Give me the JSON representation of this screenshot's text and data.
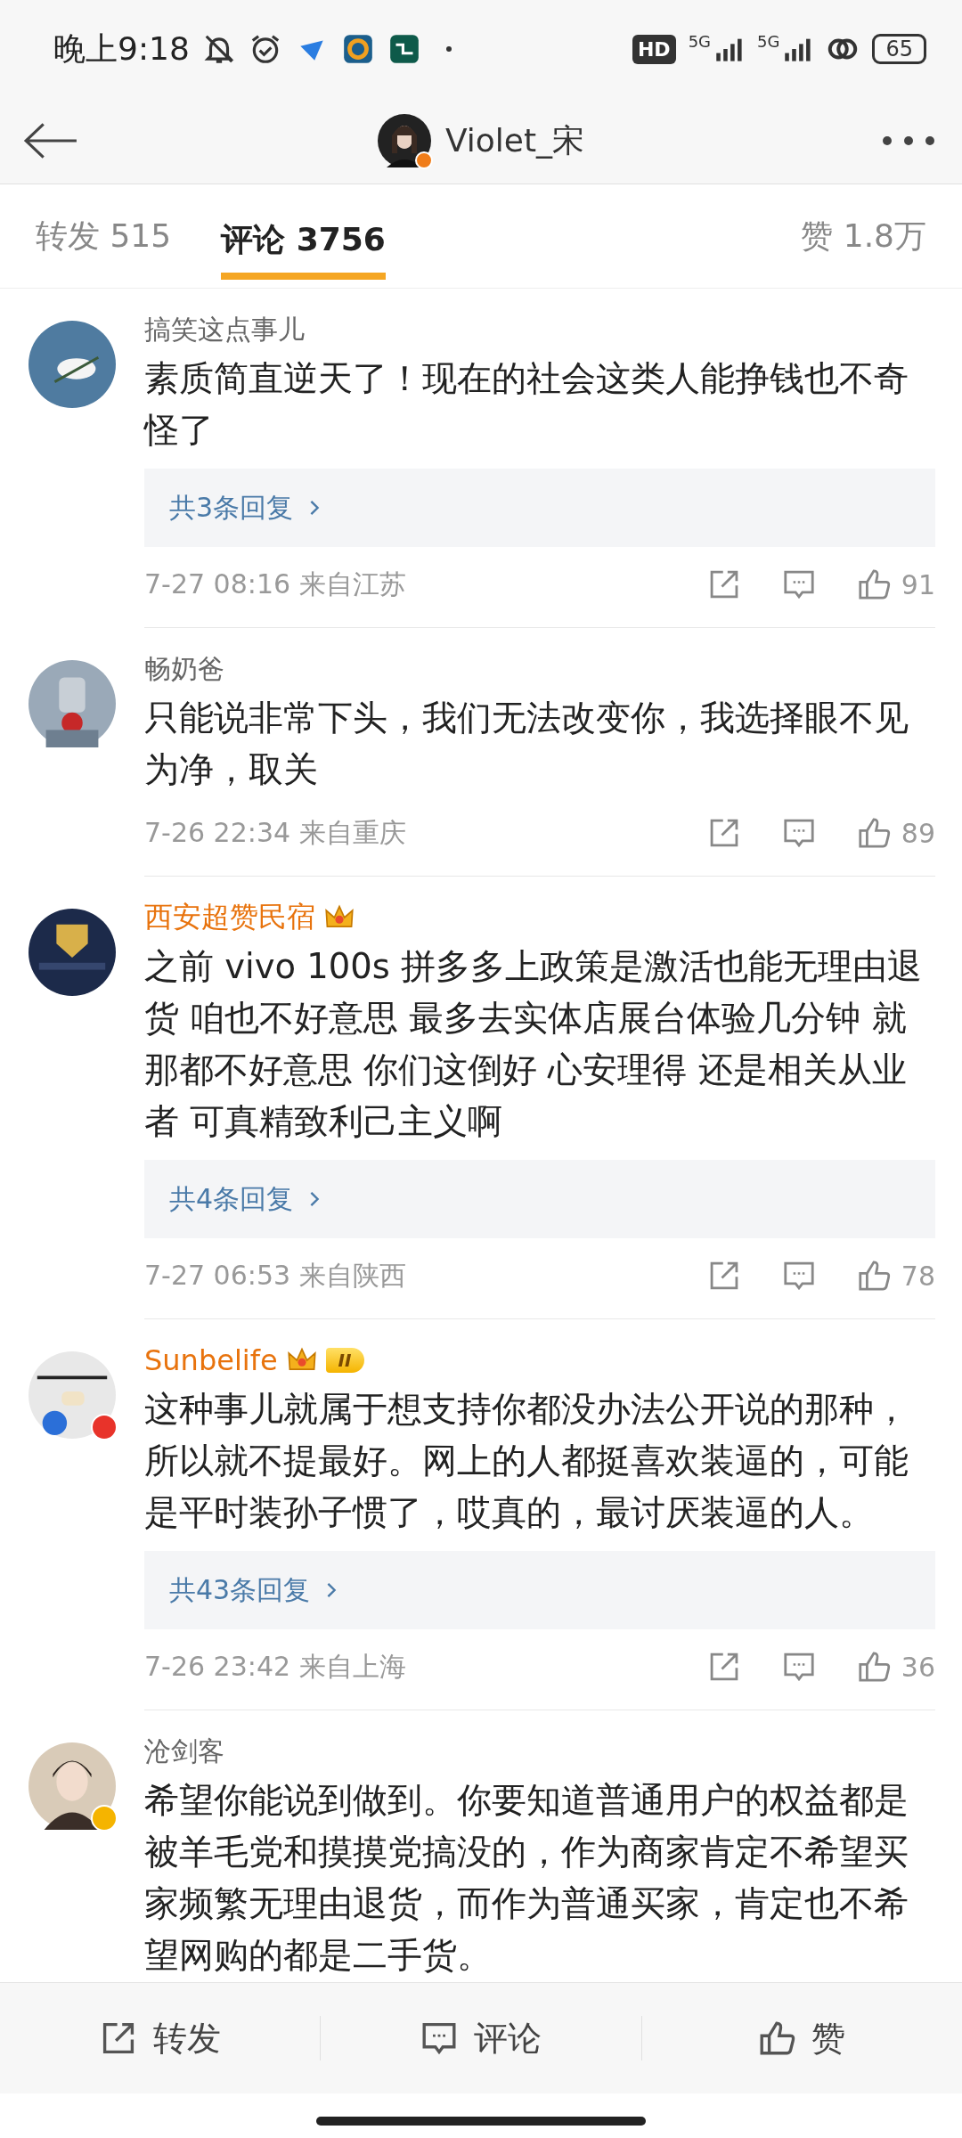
{
  "status_bar": {
    "time": "晚上9:18",
    "hd": "HD",
    "networks": [
      "5G",
      "5G"
    ],
    "battery": "65"
  },
  "header": {
    "title": "Violet_宋"
  },
  "tabs": [
    {
      "label": "转发",
      "count": "515",
      "selected": false
    },
    {
      "label": "评论",
      "count": "3756",
      "selected": true
    },
    {
      "label": "赞",
      "count": "1.8万",
      "selected": false
    }
  ],
  "comments": [
    {
      "user": "搞笑这点事儿",
      "vip": false,
      "text": "素质简直逆天了！现在的社会这类人能挣钱也不奇怪了",
      "replies": "共3条回复",
      "time": "7-27 08:16",
      "location": "来自江苏",
      "likes": "91"
    },
    {
      "user": "畅奶爸",
      "vip": false,
      "text": "只能说非常下头，我们无法改变你，我选择眼不见为净，取关",
      "time": "7-26 22:34",
      "location": "来自重庆",
      "likes": "89"
    },
    {
      "user": "西安超赞民宿",
      "vip": true,
      "crown": true,
      "text": "之前 vivo 100s 拼多多上政策是激活也能无理由退货  咱也不好意思  最多去实体店展台体验几分钟 就那都不好意思 你们这倒好  心安理得  还是相关从业者 可真精致利己主义啊",
      "replies": "共4条回复",
      "time": "7-27 06:53",
      "location": "来自陕西",
      "likes": "78"
    },
    {
      "user": "Sunbelife",
      "vip": true,
      "crown": true,
      "level": "II",
      "color": "#e8332a",
      "text": "这种事儿就属于想支持你都没办法公开说的那种，所以就不提最好。网上的人都挺喜欢装逼的，可能是平时装孙子惯了，哎真的，最讨厌装逼的人。",
      "replies": "共43条回复",
      "time": "7-26 23:42",
      "location": "来自上海",
      "likes": "36"
    },
    {
      "user": "沧剑客",
      "vip": false,
      "color": "#f5b400",
      "text": "希望你能说到做到。你要知道普通用户的权益都是被羊毛党和摸摸党搞没的，作为商家肯定不希望买家频繁无理由退货，而作为普通买家，肯定也不希望网购的都是二手货。"
    }
  ],
  "bottom_bar": [
    {
      "kind": "repost",
      "label": "转发"
    },
    {
      "kind": "comment",
      "label": "评论"
    },
    {
      "kind": "like",
      "label": "赞"
    }
  ]
}
